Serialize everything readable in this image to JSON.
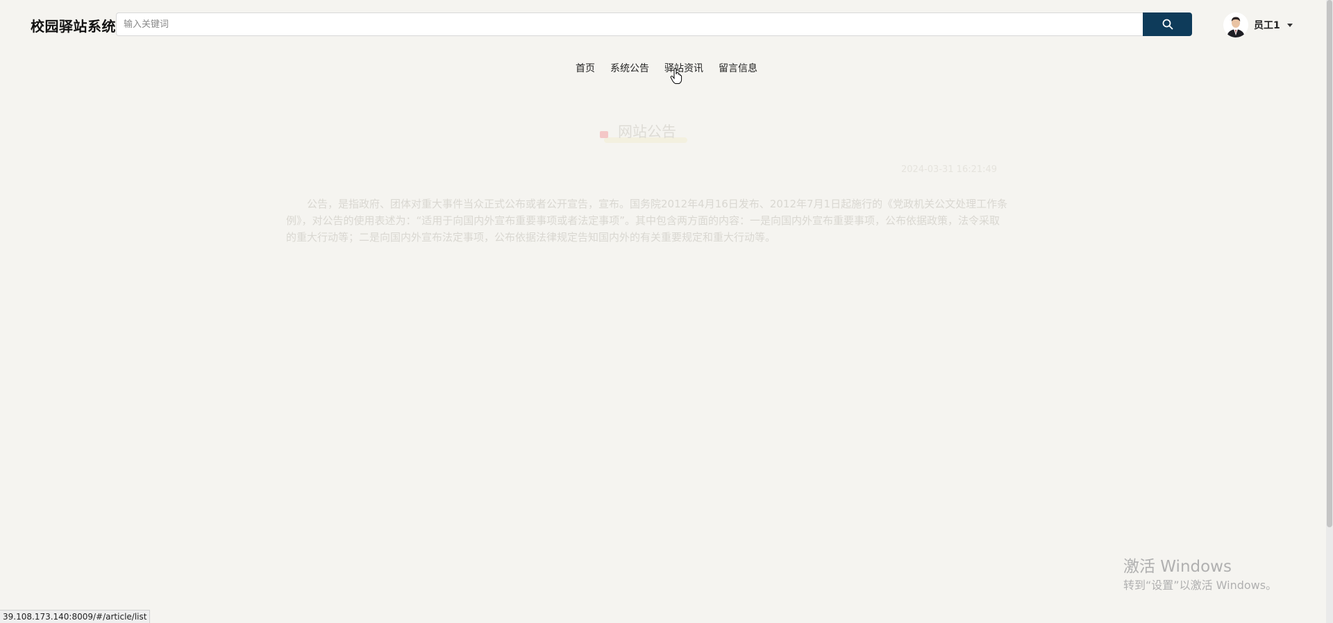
{
  "header": {
    "brand": "校园驿站系统",
    "search": {
      "placeholder": "输入关键词",
      "value": ""
    },
    "user": {
      "name": "员工1"
    }
  },
  "nav": {
    "items": [
      {
        "label": "首页"
      },
      {
        "label": "系统公告"
      },
      {
        "label": "驿站资讯"
      },
      {
        "label": "留言信息"
      }
    ]
  },
  "article": {
    "title": "网站公告",
    "date": "2024-03-31 16:21:49",
    "body": "公告，是指政府、团体对重大事件当众正式公布或者公开宣告，宣布。国务院2012年4月16日发布、2012年7月1日起施行的《党政机关公文处理工作条例》，对公告的使用表述为：“适用于向国内外宣布重要事项或者法定事项”。其中包含两方面的内容：一是向国内外宣布重要事项，公布依据政策，法令采取的重大行动等；二是向国内外宣布法定事项，公布依据法律规定告知国内外的有关重要规定和重大行动等。"
  },
  "system": {
    "watermark_title": "激活 Windows",
    "watermark_sub": "转到“设置”以激活 Windows。",
    "status_url": "39.108.173.140:8009/#/article/list"
  },
  "colors": {
    "background": "#f5f4f0",
    "accent": "#0e3b5a"
  }
}
